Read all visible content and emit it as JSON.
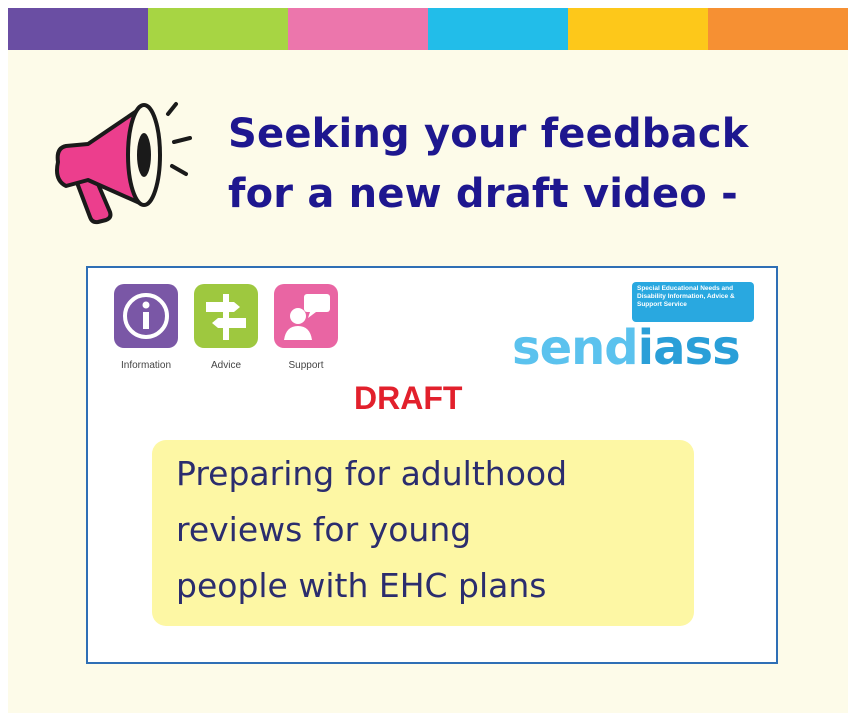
{
  "stripes": [
    "#6a4ea3",
    "#a7d543",
    "#ec76ac",
    "#22bde9",
    "#fdc81a",
    "#f69033"
  ],
  "headline": {
    "line1": "Seeking your feedback",
    "line2": "for a new draft video -"
  },
  "icons": {
    "megaphone": "megaphone-icon",
    "information": "information-icon",
    "advice": "signpost-icon",
    "support": "speech-person-icon"
  },
  "tiles": [
    {
      "label": "Information",
      "color": "#7a57a6"
    },
    {
      "label": "Advice",
      "color": "#9ec83f"
    },
    {
      "label": "Support",
      "color": "#e965a3"
    }
  ],
  "logo": {
    "tagline": "Special Educational Needs and Disability Information, Advice & Support Service",
    "wordmark_part1": "send",
    "wordmark_part2": "iass"
  },
  "draft_label": "DRAFT",
  "video_title": {
    "line1": "Preparing for adulthood",
    "line2": "reviews for young",
    "line3": "people with EHC plans"
  }
}
